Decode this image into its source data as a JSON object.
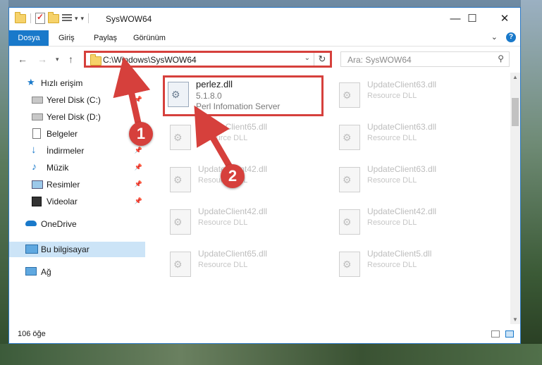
{
  "window": {
    "title": "SysWOW64",
    "minimize": "—",
    "maximize": "☐",
    "close": "✕"
  },
  "ribbon": {
    "tabs": [
      "Dosya",
      "Giriş",
      "Paylaş",
      "Görünüm"
    ],
    "help": "?"
  },
  "address": {
    "path": "C:\\Windows\\SysWOW64",
    "search_placeholder": "Ara: SysWOW64"
  },
  "nav": {
    "items": [
      {
        "label": "Hızlı erişim",
        "icon": "star-icon"
      },
      {
        "label": "Yerel Disk (C:)",
        "icon": "drive-icon"
      },
      {
        "label": "Yerel Disk (D:)",
        "icon": "drive-icon"
      },
      {
        "label": "Belgeler",
        "icon": "documents-icon"
      },
      {
        "label": "İndirmeler",
        "icon": "download-icon"
      },
      {
        "label": "Müzik",
        "icon": "music-icon"
      },
      {
        "label": "Resimler",
        "icon": "pictures-icon"
      },
      {
        "label": "Videolar",
        "icon": "videos-icon"
      },
      {
        "label": "OneDrive",
        "icon": "cloud-icon"
      },
      {
        "label": "Bu bilgisayar",
        "icon": "computer-icon"
      },
      {
        "label": "Ağ",
        "icon": "network-icon"
      }
    ]
  },
  "files": {
    "highlighted": {
      "name": "perlez.dll",
      "version": "5.1.8.0",
      "description": "Perl Infomation Server"
    },
    "tiles": [
      {
        "name": "UpdateClient63.dll",
        "desc": "Resource DLL"
      },
      {
        "name": "UpdateClient65.dll",
        "desc": "Resource DLL"
      },
      {
        "name": "UpdateClient63.dll",
        "desc": "Resource DLL"
      },
      {
        "name": "UpdateClient42.dll",
        "desc": "Resource DLL"
      },
      {
        "name": "UpdateClient63.dll",
        "desc": "Resource DLL"
      },
      {
        "name": "UpdateClient42.dll",
        "desc": "Resource DLL"
      },
      {
        "name": "UpdateClient42.dll",
        "desc": "Resource DLL"
      },
      {
        "name": "UpdateClient65.dll",
        "desc": "Resource DLL"
      },
      {
        "name": "UpdateClient5.dll",
        "desc": "Resource DLL"
      }
    ]
  },
  "status": {
    "count": "106 öğe"
  },
  "annotations": {
    "badge1": "1",
    "badge2": "2",
    "color": "#d6403c"
  }
}
